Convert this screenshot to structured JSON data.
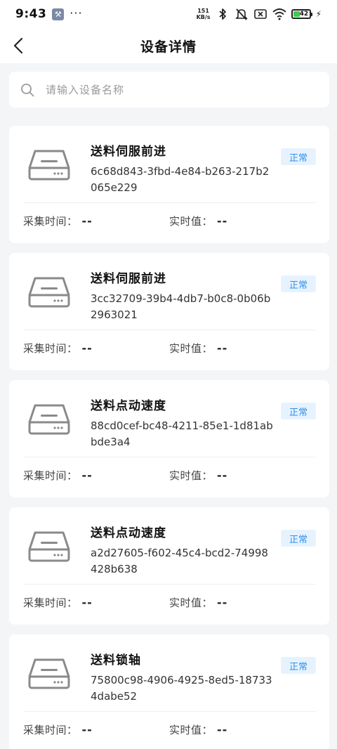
{
  "status_bar": {
    "time": "9:43",
    "more": "···",
    "net_speed_value": "151",
    "net_speed_unit": "KB/s",
    "battery_level": "42",
    "icons": [
      "wrench-icon",
      "bluetooth-icon",
      "mute-icon",
      "sim-off-icon",
      "wifi-icon",
      "battery-icon",
      "charging-icon"
    ]
  },
  "header": {
    "title": "设备详情",
    "back_icon": "chevron-left-icon"
  },
  "search": {
    "placeholder": "请输入设备名称",
    "value": ""
  },
  "labels": {
    "collect_time": "采集时间：",
    "realtime_value": "实时值："
  },
  "devices": [
    {
      "name": "送料伺服前进",
      "id": "6c68d843-3fbd-4e84-b263-217b2065e229",
      "status": "正常",
      "collect_time": "--",
      "realtime_value": "--"
    },
    {
      "name": "送料伺服前进",
      "id": "3cc32709-39b4-4db7-b0c8-0b06b2963021",
      "status": "正常",
      "collect_time": "--",
      "realtime_value": "--"
    },
    {
      "name": "送料点动速度",
      "id": "88cd0cef-bc48-4211-85e1-1d81abbde3a4",
      "status": "正常",
      "collect_time": "--",
      "realtime_value": "--"
    },
    {
      "name": "送料点动速度",
      "id": "a2d27605-f602-45c4-bcd2-74998428b638",
      "status": "正常",
      "collect_time": "--",
      "realtime_value": "--"
    },
    {
      "name": "送料锁轴",
      "id": "75800c98-4906-4925-8ed5-187334dabe52",
      "status": "正常",
      "collect_time": "--",
      "realtime_value": "--"
    }
  ],
  "colors": {
    "badge_bg": "#e6f3ff",
    "badge_text": "#2f8fe8",
    "page_bg": "#f4f5f7",
    "icon_gray": "#8a8a8a"
  }
}
